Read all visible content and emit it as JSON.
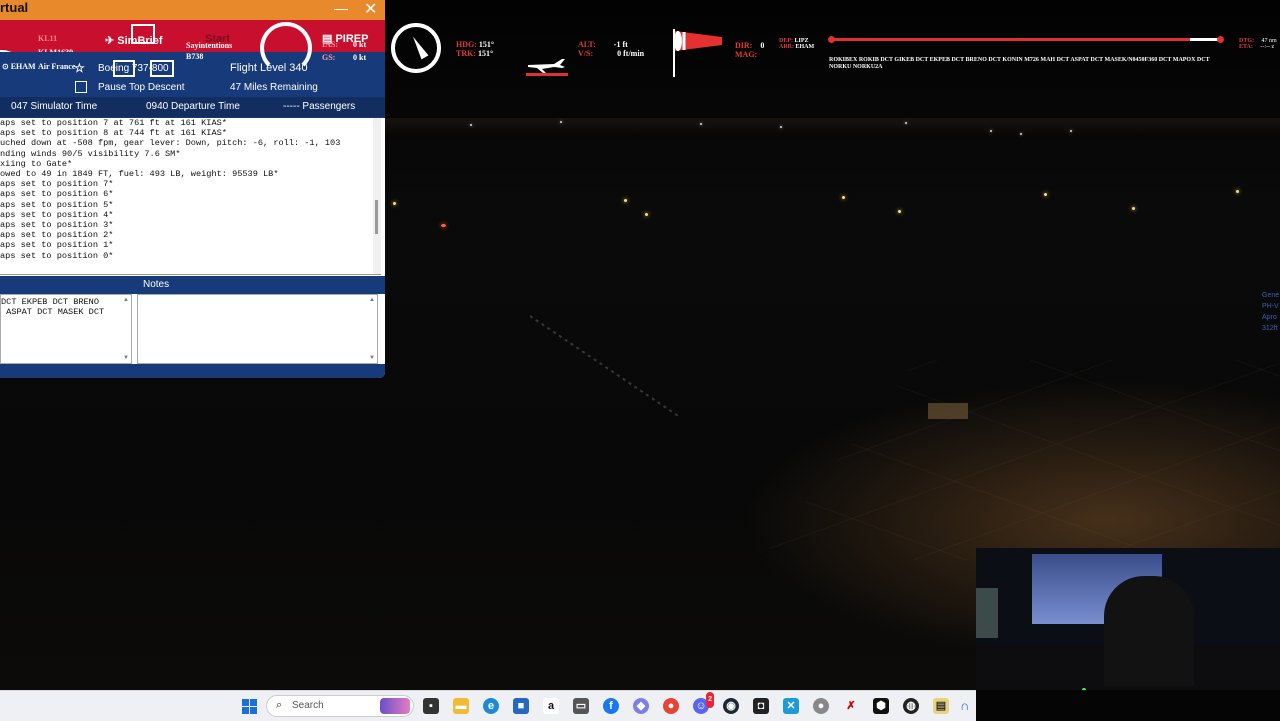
{
  "va_window": {
    "title": "rtual",
    "minimize_label": "—",
    "close_label": "✕",
    "callsign_top": "KL11",
    "callsign": "KLM1639",
    "airline": "Air France",
    "destination_short": "EHAM",
    "simbrief_label": "SimBrief",
    "start_label": "Start",
    "pirep_label": "PIREP",
    "departure_text": "Sayintentions",
    "aircraft_code": "B738",
    "ias_label": "IAS:",
    "ias_value": "0 kt",
    "gs_label": "GS:",
    "gs_value": "0 kt",
    "aircraft_name": "Boeing 737-800",
    "flight_level": "Flight Level 340",
    "pause_td_label": "Pause Top Descent",
    "pause_td_checked": false,
    "miles_remaining": "47 Miles Remaining",
    "sim_time": "047 Simulator Time",
    "departure_time": "0940 Departure Time",
    "passengers": "----- Passengers",
    "log_lines": [
      "aps set to position 7 at 761 ft at 161 KIAS*",
      "aps set to position 8 at 744 ft at 161 KIAS*",
      "uched down at -508 fpm, gear lever: Down, pitch: -6, roll: -1, 103",
      "",
      "nding winds 90/5 visibility 7.6 SM*",
      "xiing to Gate*",
      "owed to 49 in 1849 FT, fuel: 493 LB, weight: 95539 LB*",
      "aps set to position 7*",
      "aps set to position 6*",
      "aps set to position 5*",
      "aps set to position 4*",
      "aps set to position 3*",
      "aps set to position 2*",
      "aps set to position 1*",
      "aps set to position 0*"
    ],
    "notes_label": "Notes",
    "route_notes_lines": [
      "DCT EKPEB DCT BRENO",
      " ASPAT DCT MASEK DCT"
    ],
    "notes_text": ""
  },
  "hud": {
    "hdg_label": "HDG:",
    "hdg_value": "151°",
    "trk_label": "TRK:",
    "trk_value": "151°",
    "alt_label": "ALT:",
    "alt_value": "-1 ft",
    "vs_label": "V/S:",
    "vs_value": "0 ft/min",
    "dir_label": "DIR:",
    "dir_value": "0",
    "mag_label": "MAG:",
    "dep_label": "DEP:",
    "dep_value": "LIPZ",
    "arr_label": "ARR:",
    "arr_value": "EHAM",
    "route_text": "ROKIBEX ROKIB DCT GIKEB DCT EKPEB DCT BRENO DCT KONIN M726 MAH DCT ASPAT DCT MASEK/N0450F360 DCT MAPOX DCT NORKU NORKU2A",
    "dtg_label": "DTG:",
    "dtg_value": "47 nm",
    "eta_label": "ETA:",
    "eta_value": "--:-- z",
    "side_lines": [
      "Gene",
      "PH-V",
      "Apro",
      "312ft"
    ]
  },
  "taskbar": {
    "search_placeholder": "Search",
    "icons": [
      "task-view-icon",
      "file-explorer-icon",
      "edge-icon",
      "store-icon",
      "amazon-icon",
      "media-icon",
      "facebook-icon",
      "copilot-icon",
      "chrome-icon",
      "discord-icon",
      "steam-icon",
      "epic-icon",
      "excel-icon",
      "app-icon",
      "cross-icon",
      "cube-icon",
      "obs-icon",
      "notes-icon"
    ],
    "discord_badge": "2"
  },
  "colors": {
    "va_orange": "#e8892b",
    "va_red": "#c8102e",
    "va_blue": "#173a7a",
    "hud_red": "#e23a3a"
  }
}
